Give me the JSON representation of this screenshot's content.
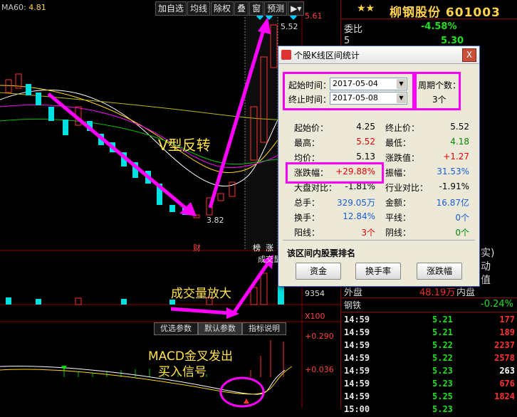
{
  "toolbar": {
    "items": [
      "加自选",
      "均线",
      "除权",
      "叠",
      "窗",
      "预测"
    ],
    "menu_arrow": "▶▾"
  },
  "ma_label": {
    "name": "MA60:",
    "value": "4.81"
  },
  "price_marks": {
    "high": "5.61",
    "peak": "5.52",
    "low": "3.82"
  },
  "chart_marks": {
    "cai": "财",
    "bang": "榜",
    "zhang": "涨",
    "chengjiao": "成交量",
    "vol_axis": "9354",
    "x100": "X100",
    "macd_top": "+0.290",
    "macd_mid": "+0.036"
  },
  "annotations": {
    "v_turn": "V型反转",
    "volume": "成交量放大",
    "macd1": "MACD金叉发出",
    "macd2": "买入信号"
  },
  "subtabs": [
    "优选参数",
    "默认参数",
    "指标说明"
  ],
  "stock": {
    "title": "柳钢股份 601003",
    "stars": "★★"
  },
  "right_rows": {
    "weibi_label": "委比",
    "weibi_value": "-4.58%",
    "sell5_label": "5",
    "sell5_price": "5.30",
    "waipan_label": "外盘",
    "waipan_value": "48.19万",
    "neipan_label": "内盘",
    "sector_name": "钢铁",
    "sector_change": "-0.24%",
    "side_text_1": "实)",
    "side_text_2": "动",
    "side_text_3": "值"
  },
  "trades": [
    {
      "t": "14:59",
      "p": "5.21",
      "v": "177"
    },
    {
      "t": "14:59",
      "p": "5.21",
      "v": "189"
    },
    {
      "t": "14:59",
      "p": "5.22",
      "v": "2237"
    },
    {
      "t": "14:59",
      "p": "5.22",
      "v": "2578"
    },
    {
      "t": "14:59",
      "p": "5.23",
      "v": "263"
    },
    {
      "t": "14:59",
      "p": "5.23",
      "v": "676"
    },
    {
      "t": "14:59",
      "p": "5.25",
      "v": "1824"
    },
    {
      "t": "15:00",
      "p": "5.23",
      "v": ""
    }
  ],
  "dialog": {
    "title": "个股K线区间统计",
    "close": "X",
    "start_label": "起始时间：",
    "start_value": "2017-05-04",
    "end_label": "终止时间：",
    "end_value": "2017-05-08",
    "period_label": "周期个数：",
    "period_value": "3个",
    "stats": [
      {
        "l": "起始价：",
        "v": "4.25",
        "c": "black",
        "l2": "终止价：",
        "v2": "5.52",
        "c2": "black"
      },
      {
        "l": "最高：",
        "v": "5.52",
        "c": "red",
        "l2": "最低：",
        "v2": "4.18",
        "c2": "green"
      },
      {
        "l": "均价：",
        "v": "5.13",
        "c": "black",
        "l2": "涨跌值：",
        "v2": "+1.27",
        "c2": "red"
      },
      {
        "l": "涨跌幅：",
        "v": "+29.88%",
        "c": "red",
        "l2": "振幅：",
        "v2": "31.53%",
        "c2": "blue"
      },
      {
        "l": "大盘对比：",
        "v": "-1.81%",
        "c": "black",
        "l2": "行业对比：",
        "v2": "-1.91%",
        "c2": "black"
      },
      {
        "l": "总手：",
        "v": "329.05万",
        "c": "blue",
        "l2": "金额：",
        "v2": "16.87亿",
        "c2": "blue"
      },
      {
        "l": "换手：",
        "v": "12.84%",
        "c": "blue",
        "l2": "平线：",
        "v2": "0个",
        "c2": "blue"
      },
      {
        "l": "阳线：",
        "v": "3个",
        "c": "red",
        "l2": "阴线：",
        "v2": "0个",
        "c2": "green"
      }
    ],
    "rank_title": "该区间内股票排名",
    "rank_buttons": [
      "资金",
      "换手率",
      "涨跌幅"
    ]
  },
  "colors": {
    "up": "#ff3030",
    "down": "#00e0e0",
    "highlight": "#ff00ff",
    "accent": "#ffd24a"
  }
}
